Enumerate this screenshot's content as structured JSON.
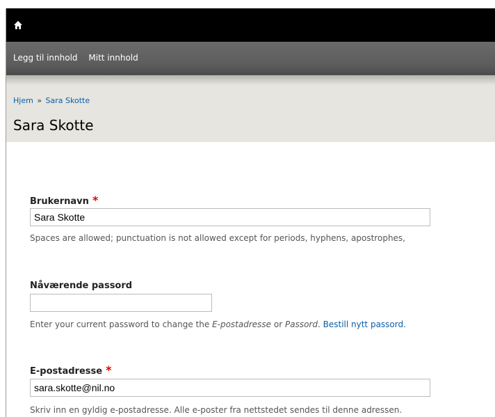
{
  "toolbar": {
    "home_icon": "home-icon",
    "shortcuts": [
      "Legg til innhold",
      "Mitt innhold"
    ]
  },
  "header": {
    "breadcrumb": {
      "home": "Hjem",
      "separator": "»",
      "current": "Sara Skotte"
    },
    "title": "Sara Skotte"
  },
  "form": {
    "username": {
      "label": "Brukernavn",
      "required_marker": "*",
      "value": "Sara Skotte",
      "description": "Spaces are allowed; punctuation is not allowed except for periods, hyphens, apostrophes,"
    },
    "current_password": {
      "label": "Nåværende passord",
      "value": "",
      "desc_prefix": "Enter your current password to change the ",
      "desc_email": "E-postadresse",
      "desc_or": " or ",
      "desc_password": "Passord",
      "desc_dot": ". ",
      "desc_link": "Bestill nytt passord."
    },
    "email": {
      "label": "E-postadresse",
      "required_marker": "*",
      "value": "sara.skotte@nil.no",
      "description": "Skriv inn en gyldig e-postadresse. Alle e-poster fra nettstedet sendes til denne adressen."
    }
  }
}
